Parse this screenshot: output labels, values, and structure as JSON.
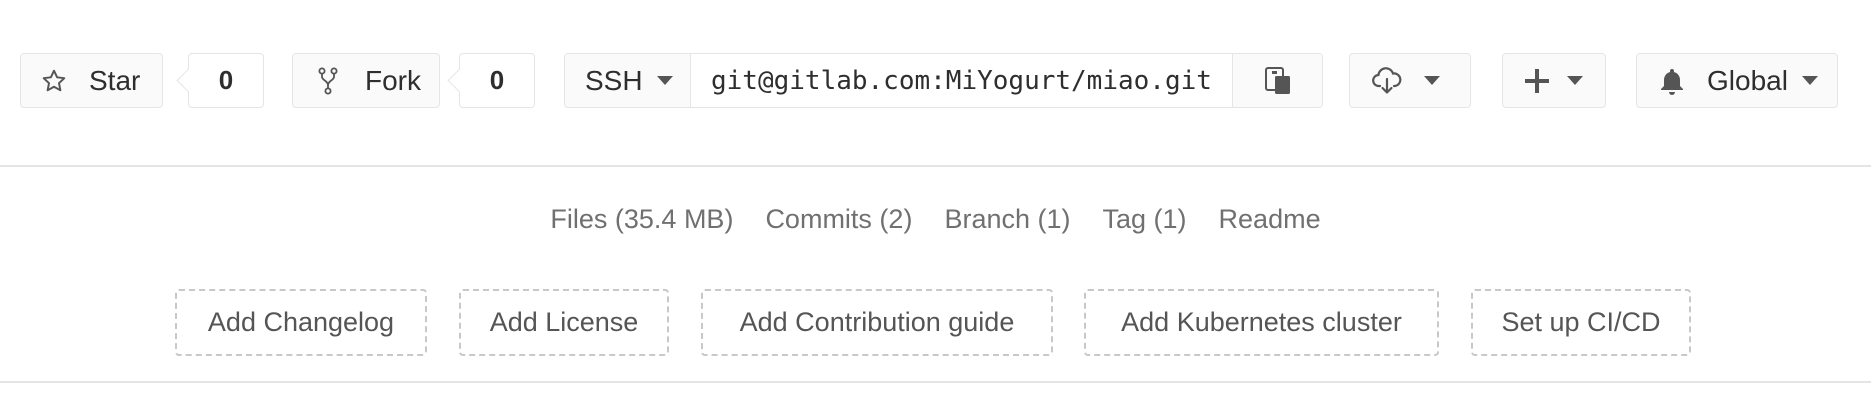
{
  "toolbar": {
    "star_label": "Star",
    "star_count": "0",
    "fork_label": "Fork",
    "fork_count": "0",
    "clone": {
      "protocol": "SSH",
      "url": "git@gitlab.com:MiYogurt/miao.git"
    },
    "notification_label": "Global",
    "icons": {
      "star": "star-outline-icon",
      "fork": "fork-icon",
      "copy": "clipboard-icon",
      "download": "cloud-download-icon",
      "add": "plus-icon",
      "bell": "bell-icon"
    }
  },
  "stats": {
    "files": "Files (35.4 MB)",
    "commits": "Commits (2)",
    "branch": "Branch (1)",
    "tag": "Tag (1)",
    "readme": "Readme"
  },
  "actions": {
    "changelog": "Add Changelog",
    "license": "Add License",
    "contribution": "Add Contribution guide",
    "kubernetes": "Add Kubernetes cluster",
    "cicd": "Set up CI/CD"
  },
  "colors": {
    "border": "#e5e5e5",
    "dashed_border": "#c8c8c8",
    "button_bg": "#fafafa",
    "muted_text": "#707070"
  }
}
